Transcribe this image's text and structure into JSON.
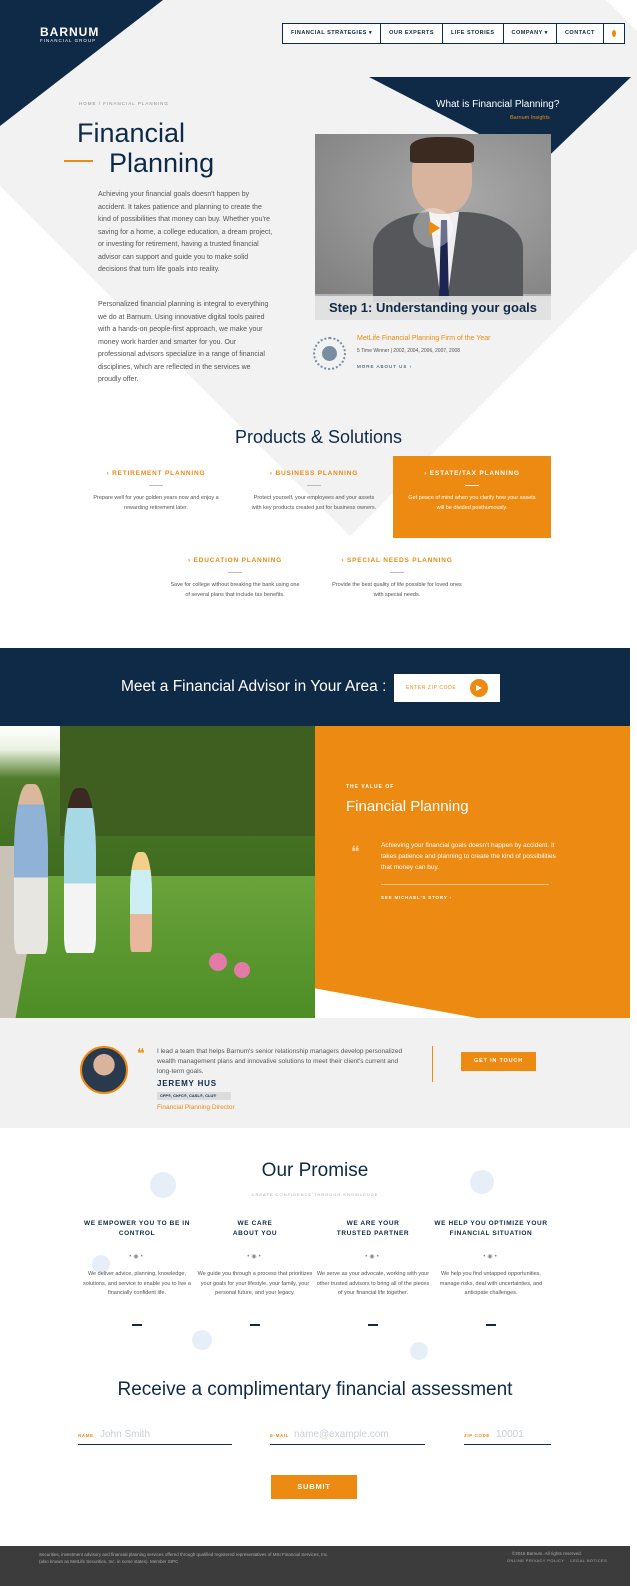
{
  "brand": {
    "name": "BARNUM",
    "sub": "FINANCIAL GROUP"
  },
  "nav": {
    "items": [
      "FINANCIAL STRATEGIES ▾",
      "OUR EXPERTS",
      "LIFE STORIES",
      "COMPANY ▾",
      "CONTACT"
    ]
  },
  "breadcrumb": {
    "home": "HOME",
    "sep": "/",
    "current": "FINANCIAL PLANNING"
  },
  "hero": {
    "title_line1": "Financial",
    "title_line2": "Planning",
    "para1": "Achieving your financial goals doesn't happen by accident.  It takes patience and planning to create the kind of possibilities that money can buy.  Whether you're saving for a home, a college education, a dream project, or investing for retirement, having a trusted financial advisor can support and guide you to make solid decisions that turn life goals into reality.",
    "para2": "Personalized financial planning is integral to everything we do at Barnum. Using innovative digital tools paired with a hands-on people-first approach, we make your money work harder and smarter for you.  Our professional advisors specialize in a range of financial disciplines, which are reflected in the services we proudly offer."
  },
  "insights": {
    "title": "What is Financial Planning?",
    "sub": "Barnum Insights"
  },
  "video": {
    "caption": "Step 1: Understanding your goals"
  },
  "award": {
    "title": "MetLife Financial Planning Firm of the Year",
    "sub": "5 Time Winner | 2002, 2004, 2006, 2007, 2008",
    "link": "MORE ABOUT US   ›"
  },
  "products": {
    "title": "Products & Solutions",
    "items": [
      {
        "name": "› RETIREMENT PLANNING",
        "desc": "Prepare well for your golden years now and enjoy a rewarding retirement later."
      },
      {
        "name": "› BUSINESS PLANNING",
        "desc": "Protect yourself, your employees and your assets with key products created just for business owners."
      },
      {
        "name": "› ESTATE/TAX PLANNING",
        "desc": "Get peace of mind when you clarify how your assets will be divided posthumously."
      },
      {
        "name": "› EDUCATION PLANNING",
        "desc": "Save for college without breaking the bank using one of several plans that include tax benefits."
      },
      {
        "name": "› SPECIAL NEEDS PLANNING",
        "desc": "Provide the best quality of life possible for loved ones with special needs."
      }
    ]
  },
  "advisor": {
    "title": "Meet a Financial Advisor in Your Area :",
    "zip_placeholder": "ENTER ZIP CODE"
  },
  "value": {
    "label": "THE VALUE OF",
    "title": "Financial Planning",
    "quote": "Achieving your financial goals doesn't happen by accident. It takes patience and planning to create the kind of possibilities that money can buy.",
    "link": "SEE MICHAEL'S STORY   ›"
  },
  "testimonial": {
    "quote": "I lead a team that helps Barnum's senior relationship managers develop personalized wealth management plans and innovative solutions to meet their client's current and long-term goals.",
    "name": "JEREMY HUS",
    "creds": "CFP®, ChFC®, CASL®, CLU®",
    "role": "Financial Planning Director",
    "cta": "GET IN TOUCH"
  },
  "promise": {
    "title": "Our Promise",
    "sub": "CREATE CONFIDENCE THROUGH KNOWLEDGE",
    "items": [
      {
        "title": "WE EMPOWER YOU TO BE IN CONTROL",
        "desc": "We deliver advice, planning, knowledge, solutions, and service to enable you to live a financially confident life."
      },
      {
        "title": "WE CARE ABOUT YOU",
        "desc": "We guide you through a process that prioritizes your goals for your lifestyle, your family, your personal future, and your legacy."
      },
      {
        "title": "WE ARE YOUR TRUSTED PARTNER",
        "desc": "We serve as your advocate, working with your other trusted advisors to bring all of the pieces of your financial life together."
      },
      {
        "title": "WE HELP YOU OPTIMIZE YOUR FINANCIAL SITUATION",
        "desc": "We help you find untapped opportunities, manage risks, deal with uncertainties, and anticipate challenges."
      }
    ]
  },
  "form": {
    "title": "Receive a complimentary financial assessment",
    "name_label": "NAME",
    "name_placeholder": "John Smith",
    "email_label": "E-MAIL",
    "email_placeholder": "name@example.com",
    "zip_label": "ZIP CODE",
    "zip_placeholder": "10001",
    "submit": "SUBMIT"
  },
  "footer": {
    "legal": "Securities, investment advisory and financial planning services offered through qualified registered representatives of MSI Financial Services, Inc. (also known as MetLife Securities, Inc. in some states). Member SIPC",
    "copyright": "©2016 Barnum. All rights reserved.",
    "links": [
      "ONLINE PRIVACY POLICY",
      "LEGAL NOTICES"
    ]
  },
  "colors": {
    "navy": "#0f2a47",
    "orange": "#ec8a12"
  }
}
